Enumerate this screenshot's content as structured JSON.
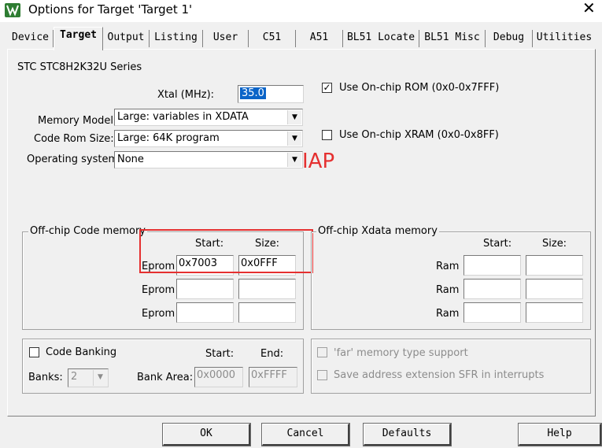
{
  "window": {
    "title": "Options for Target 'Target 1'",
    "close_glyph": "✕",
    "app_icon": "keil-uvision-icon"
  },
  "tabs": [
    "Device",
    "Target",
    "Output",
    "Listing",
    "User",
    "C51",
    "A51",
    "BL51 Locate",
    "BL51 Misc",
    "Debug",
    "Utilities"
  ],
  "active_tab": "Target",
  "target": {
    "device_name": "STC STC8H2K32U Series",
    "xtal_label": "Xtal (MHz):",
    "xtal_value": "35.0",
    "memory_model_label": "Memory Model:",
    "memory_model_value": "Large: variables in XDATA",
    "code_rom_label": "Code Rom Size:",
    "code_rom_value": "Large: 64K program",
    "os_label": "Operating system:",
    "os_value": "None",
    "use_onchip_rom": {
      "label": "Use On-chip ROM (0x0-0x7FFF)",
      "checked": true
    },
    "use_onchip_xram": {
      "label": "Use On-chip XRAM (0x0-0x8FF)",
      "checked": false
    }
  },
  "annotation": {
    "text": "IAP",
    "color": "#e53030"
  },
  "offchip_code": {
    "title": "Off-chip Code memory",
    "start_header": "Start:",
    "size_header": "Size:",
    "rows": [
      {
        "label": "Eprom",
        "start": "0x7003",
        "size": "0x0FFF"
      },
      {
        "label": "Eprom",
        "start": "",
        "size": ""
      },
      {
        "label": "Eprom",
        "start": "",
        "size": ""
      }
    ]
  },
  "offchip_xdata": {
    "title": "Off-chip Xdata memory",
    "start_header": "Start:",
    "size_header": "Size:",
    "rows": [
      {
        "label": "Ram",
        "start": "",
        "size": ""
      },
      {
        "label": "Ram",
        "start": "",
        "size": ""
      },
      {
        "label": "Ram",
        "start": "",
        "size": ""
      }
    ]
  },
  "banking": {
    "code_banking_label": "Code Banking",
    "code_banking_checked": false,
    "start_header": "Start:",
    "end_header": "End:",
    "banks_label": "Banks:",
    "banks_value": "2",
    "bank_area_label": "Bank Area:",
    "bank_area_start": "0x0000",
    "bank_area_end": "0xFFFF"
  },
  "options": {
    "far_memory_label": "'far' memory type support",
    "save_sfr_label": "Save address extension SFR in interrupts"
  },
  "buttons": {
    "ok": "OK",
    "cancel": "Cancel",
    "defaults": "Defaults",
    "help": "Help"
  }
}
